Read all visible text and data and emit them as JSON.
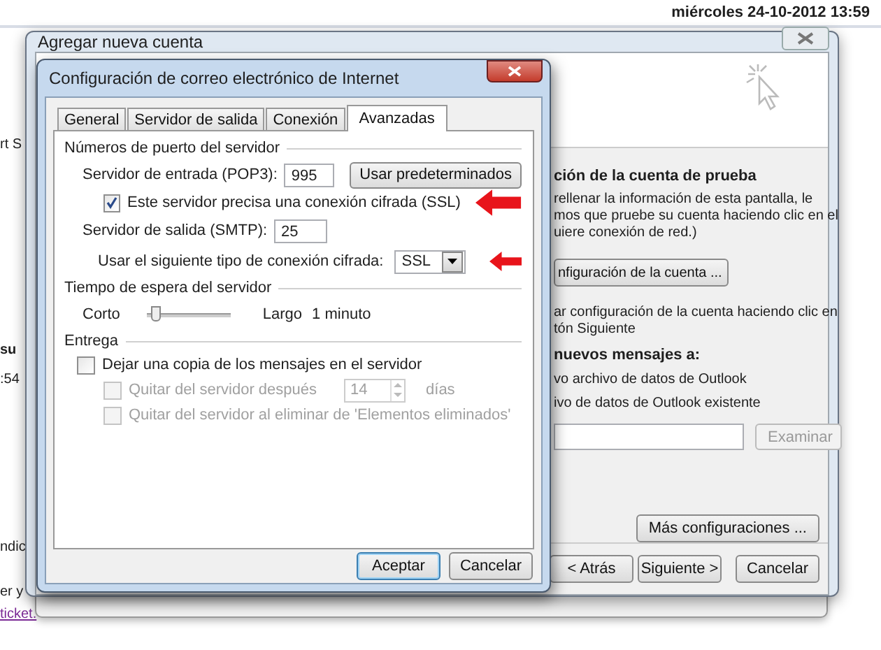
{
  "background_page": {
    "datetime": "miércoles 24-10-2012 13:59",
    "left_fragments": [
      {
        "text": "rt S",
        "kind": "plain"
      },
      {
        "text": "su",
        "kind": "heading"
      },
      {
        "text": ":54",
        "kind": "plain"
      },
      {
        "text": "ndic",
        "kind": "plain"
      },
      {
        "text": "er y",
        "kind": "plain"
      },
      {
        "text": "ticket.",
        "kind": "link"
      }
    ]
  },
  "account_wizard": {
    "title": "Agregar nueva cuenta",
    "heading": "ción de la cuenta de prueba",
    "intro_lines": [
      "rellenar la información de esta pantalla, le",
      "mos que pruebe su cuenta haciendo clic en el",
      "uiere conexión de red.)"
    ],
    "test_button": "nfiguración de la cuenta ...",
    "test_note_lines": [
      "ar configuración de la cuenta haciendo clic en",
      "tón Siguiente"
    ],
    "deliver_heading": "nuevos mensajes a:",
    "deliver_options": [
      "vo archivo de datos de Outlook",
      "ivo de datos de Outlook existente"
    ],
    "browse_button": {
      "label": "Examinar",
      "disabled": true
    },
    "more_settings_button": "Más configuraciones ...",
    "buttons": [
      "< Atrás",
      "Siguiente >",
      "Cancelar"
    ]
  },
  "settings_dialog": {
    "title": "Configuración de correo electrónico de Internet",
    "tabs": [
      {
        "label": "General",
        "selected": false
      },
      {
        "label": "Servidor de salida",
        "selected": false
      },
      {
        "label": "Conexión",
        "selected": false
      },
      {
        "label": "Avanzadas",
        "selected": true
      }
    ],
    "port_section": {
      "title": "Números de puerto del servidor",
      "incoming": {
        "label": "Servidor de entrada (POP3):",
        "value": "995"
      },
      "defaults_button": "Usar predeterminados",
      "ssl_required": {
        "label": "Este servidor precisa una conexión cifrada (SSL)",
        "checked": true
      },
      "outgoing": {
        "label": "Servidor de salida (SMTP):",
        "value": "25"
      },
      "encryption": {
        "label": "Usar el siguiente tipo de conexión cifrada:",
        "value": "SSL"
      }
    },
    "timeout_section": {
      "title": "Tiempo de espera del servidor",
      "min_label": "Corto",
      "max_label": "Largo",
      "level": 0.05,
      "reading": "1 minuto"
    },
    "delivery_section": {
      "title": "Entrega",
      "options": [
        {
          "label": "Dejar una copia de los mensajes en el servidor",
          "checked": false,
          "disabled": false
        },
        {
          "label": "Quitar del servidor después",
          "checked": false,
          "disabled": true,
          "days": "14",
          "unit": "días"
        },
        {
          "label": "Quitar del servidor al eliminar de 'Elementos eliminados'",
          "checked": false,
          "disabled": true
        }
      ]
    },
    "buttons": [
      "Aceptar",
      "Cancelar"
    ]
  }
}
